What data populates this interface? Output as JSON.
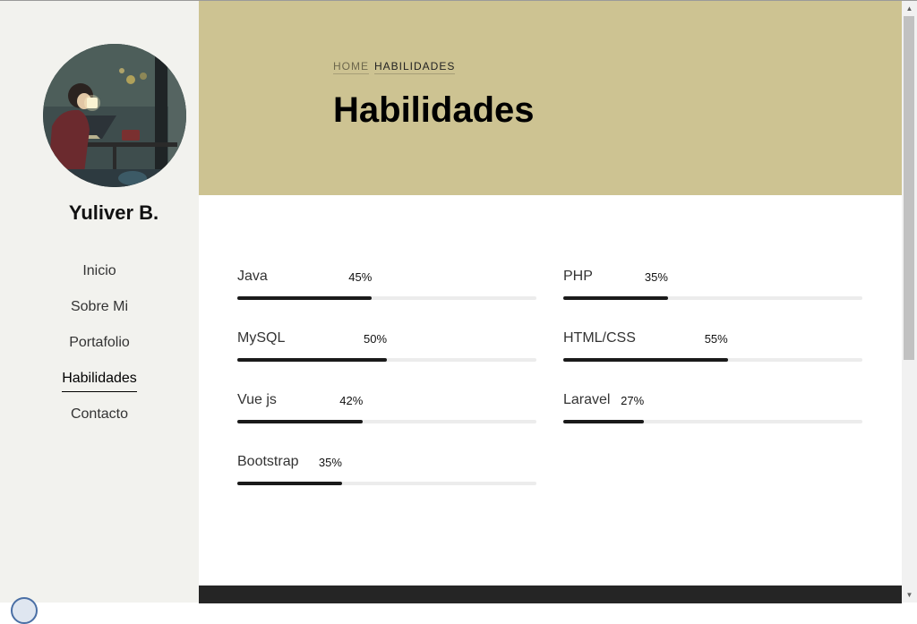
{
  "sidebar": {
    "name": "Yuliver B.",
    "avatar": "avatar-illustration",
    "nav": [
      {
        "label": "Inicio",
        "active": false
      },
      {
        "label": "Sobre Mi",
        "active": false
      },
      {
        "label": "Portafolio",
        "active": false
      },
      {
        "label": "Habilidades",
        "active": true
      },
      {
        "label": "Contacto",
        "active": false
      }
    ]
  },
  "hero": {
    "breadcrumb": [
      "HOME",
      "HABILIDADES"
    ],
    "title": "Habilidades",
    "background": "#cdc392"
  },
  "skills": [
    {
      "name": "Java",
      "percent_label": "45%",
      "percent": 45
    },
    {
      "name": "PHP",
      "percent_label": "35%",
      "percent": 35
    },
    {
      "name": "MySQL",
      "percent_label": "50%",
      "percent": 50
    },
    {
      "name": "HTML/CSS",
      "percent_label": "55%",
      "percent": 55
    },
    {
      "name": "Vue js",
      "percent_label": "42%",
      "percent": 42
    },
    {
      "name": "Laravel",
      "percent_label": "27%",
      "percent": 27
    },
    {
      "name": "Bootstrap",
      "percent_label": "35%",
      "percent": 35
    }
  ],
  "colors": {
    "sidebar_bg": "#f2f2ee",
    "hero_bg": "#cdc392",
    "bar_fill": "#1a1a1a",
    "bar_track": "#ececec",
    "footer_bg": "#252525"
  }
}
